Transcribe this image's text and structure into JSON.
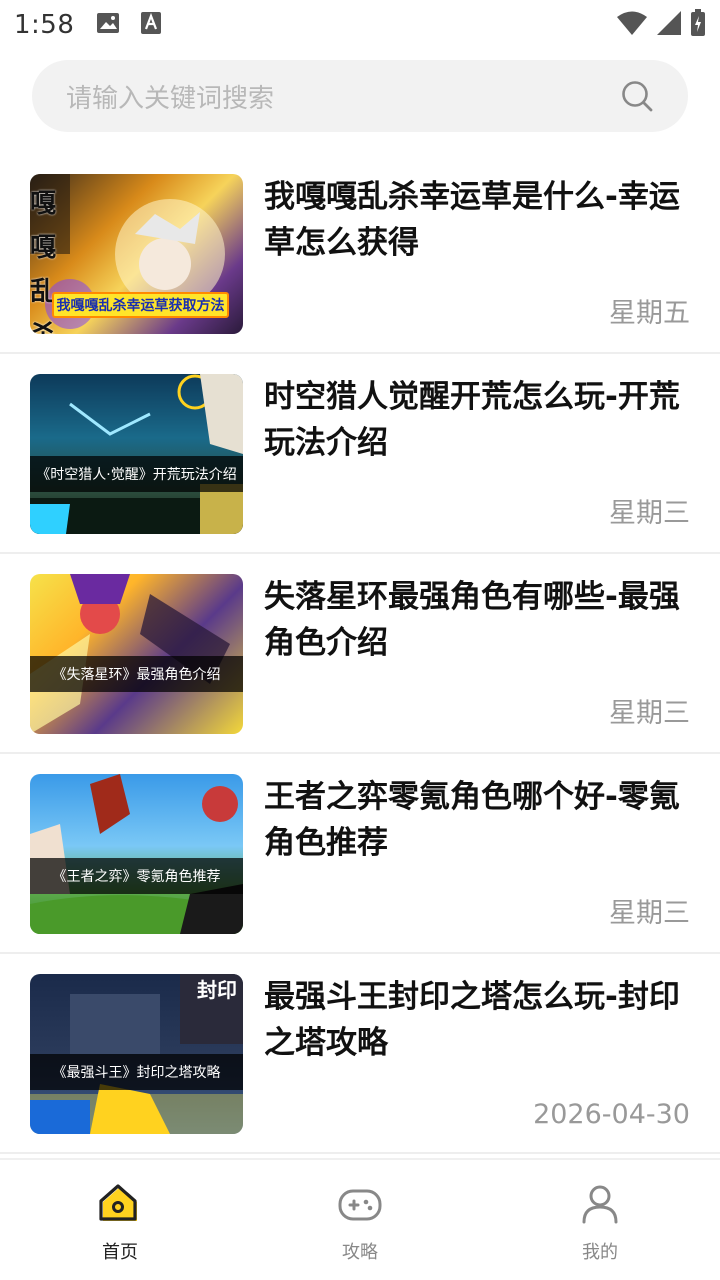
{
  "status_bar": {
    "time": "1:58"
  },
  "search": {
    "placeholder": "请输入关键词搜索"
  },
  "articles": [
    {
      "title": "我嘎嘎乱杀幸运草是什么-幸运草怎么获得",
      "date": "星期五",
      "thumb_caption": "我嘎嘎乱杀幸运草获取方法",
      "thumb_banner_text": "嘎嘎 乱杀"
    },
    {
      "title": "时空猎人觉醒开荒怎么玩-开荒玩法介绍",
      "date": "星期三",
      "thumb_caption": "《时空猎人·觉醒》开荒玩法介绍"
    },
    {
      "title": "失落星环最强角色有哪些-最强角色介绍",
      "date": "星期三",
      "thumb_caption": "《失落星环》最强角色介绍"
    },
    {
      "title": "王者之弈零氪角色哪个好-零氪角色推荐",
      "date": "星期三",
      "thumb_caption": "《王者之弈》零氪角色推荐"
    },
    {
      "title": "最强斗王封印之塔怎么玩-封印之塔攻略",
      "date": "2026-04-30",
      "thumb_caption": "《最强斗王》封印之塔攻略",
      "thumb_banner_text": "封印"
    }
  ],
  "nav": [
    {
      "label": "首页",
      "icon": "home-icon",
      "active": true
    },
    {
      "label": "攻略",
      "icon": "gamepad-icon",
      "active": false
    },
    {
      "label": "我的",
      "icon": "user-icon",
      "active": false
    }
  ],
  "colors": {
    "accent": "#ffd21f",
    "date": "#999999",
    "search_bg": "#f2f2f2"
  }
}
